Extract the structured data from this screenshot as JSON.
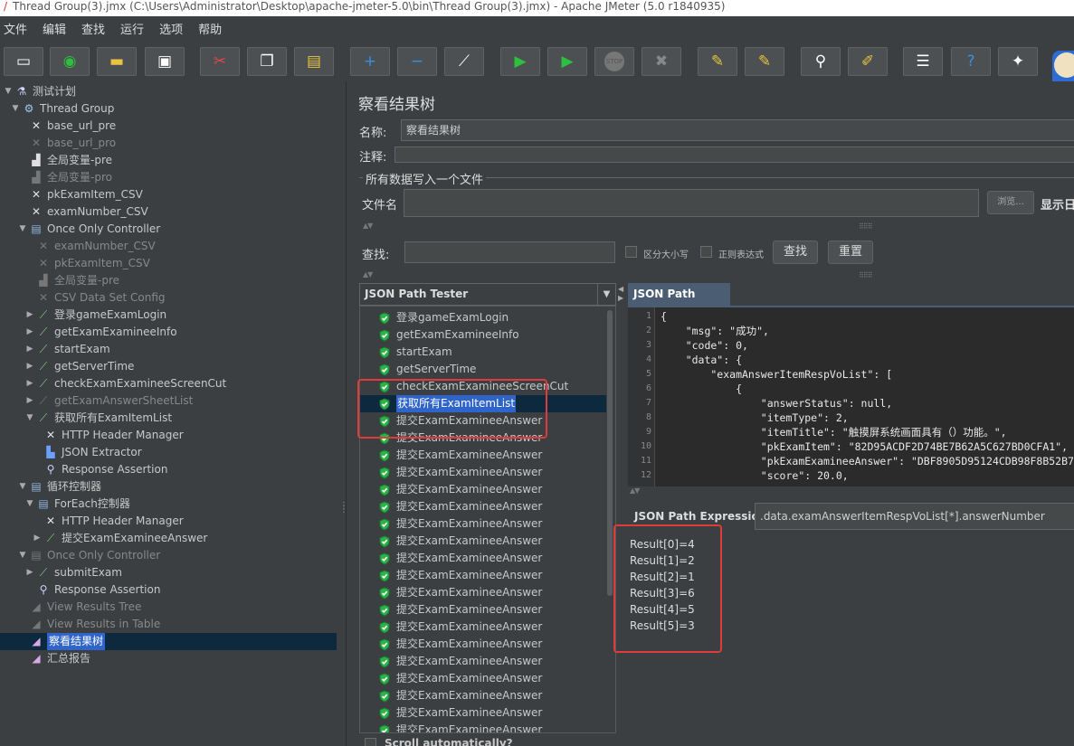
{
  "window": {
    "title": "Thread Group(3).jmx (C:\\Users\\Administrator\\Desktop\\apache-jmeter-5.0\\bin\\Thread Group(3).jmx) - Apache JMeter (5.0 r1840935)"
  },
  "menu": [
    "文件",
    "编辑",
    "查找",
    "运行",
    "选项",
    "帮助"
  ],
  "toolbar": {
    "icons": [
      "new-icon",
      "templates-icon",
      "open-icon",
      "save-icon",
      "cut-icon",
      "copy-icon",
      "paste-icon",
      "expand-icon",
      "collapse-icon",
      "toggle-icon",
      "start-icon",
      "start-no-pause-icon",
      "stop-icon",
      "shutdown-icon",
      "clear-icon",
      "clear-all-icon",
      "search-icon",
      "reset-search-icon",
      "function-helper-icon",
      "help-icon",
      "remote-icon"
    ],
    "stop_text": "STOP"
  },
  "tree": [
    {
      "label": "测试计划",
      "level": 0,
      "arrow": "▼",
      "icon": "flask-icon",
      "disabled": false
    },
    {
      "label": "Thread Group",
      "level": 1,
      "arrow": "▼",
      "icon": "gear-icon",
      "disabled": false
    },
    {
      "label": "base_url_pre",
      "level": 2,
      "arrow": "",
      "icon": "config-tool-icon",
      "disabled": false
    },
    {
      "label": "base_url_pro",
      "level": 2,
      "arrow": "",
      "icon": "config-tool-icon",
      "disabled": true
    },
    {
      "label": "全局变量-pre",
      "level": 2,
      "arrow": "",
      "icon": "preprocessor-icon",
      "disabled": false
    },
    {
      "label": "全局变量-pro",
      "level": 2,
      "arrow": "",
      "icon": "preprocessor-icon",
      "disabled": true
    },
    {
      "label": "pkExamItem_CSV",
      "level": 2,
      "arrow": "",
      "icon": "config-tool-icon",
      "disabled": false
    },
    {
      "label": "examNumber_CSV",
      "level": 2,
      "arrow": "",
      "icon": "config-tool-icon",
      "disabled": false
    },
    {
      "label": "Once Only Controller",
      "level": 2,
      "arrow": "▼",
      "icon": "controller-icon",
      "disabled": false
    },
    {
      "label": "examNumber_CSV",
      "level": 3,
      "arrow": "",
      "icon": "config-tool-icon",
      "disabled": true
    },
    {
      "label": "pkExamItem_CSV",
      "level": 3,
      "arrow": "",
      "icon": "config-tool-icon",
      "disabled": true
    },
    {
      "label": "全局变量-pre",
      "level": 3,
      "arrow": "",
      "icon": "preprocessor-icon",
      "disabled": true
    },
    {
      "label": "CSV Data Set Config",
      "level": 3,
      "arrow": "",
      "icon": "config-tool-icon",
      "disabled": true
    },
    {
      "label": "登录gameExamLogin",
      "level": 3,
      "arrow": "▶",
      "icon": "sampler-icon",
      "disabled": false
    },
    {
      "label": "getExamExamineeInfo",
      "level": 3,
      "arrow": "▶",
      "icon": "sampler-icon",
      "disabled": false
    },
    {
      "label": "startExam",
      "level": 3,
      "arrow": "▶",
      "icon": "sampler-icon",
      "disabled": false
    },
    {
      "label": "getServerTime",
      "level": 3,
      "arrow": "▶",
      "icon": "sampler-icon",
      "disabled": false
    },
    {
      "label": "checkExamExamineeScreenCut",
      "level": 3,
      "arrow": "▶",
      "icon": "sampler-icon",
      "disabled": false
    },
    {
      "label": "getExamAnswerSheetList",
      "level": 3,
      "arrow": "▶",
      "icon": "sampler-icon",
      "disabled": true
    },
    {
      "label": "获取所有ExamItemList",
      "level": 3,
      "arrow": "▼",
      "icon": "sampler-icon",
      "disabled": false
    },
    {
      "label": "HTTP Header Manager",
      "level": 4,
      "arrow": "",
      "icon": "config-tool-icon",
      "disabled": false
    },
    {
      "label": "JSON Extractor",
      "level": 4,
      "arrow": "",
      "icon": "extractor-icon",
      "disabled": false
    },
    {
      "label": "Response Assertion",
      "level": 4,
      "arrow": "",
      "icon": "assertion-icon",
      "disabled": false
    },
    {
      "label": "循环控制器",
      "level": 2,
      "arrow": "▼",
      "icon": "controller-icon",
      "disabled": false
    },
    {
      "label": "ForEach控制器",
      "level": 3,
      "arrow": "▼",
      "icon": "controller-icon",
      "disabled": false
    },
    {
      "label": "HTTP Header Manager",
      "level": 4,
      "arrow": "",
      "icon": "config-tool-icon",
      "disabled": false
    },
    {
      "label": "提交ExamExamineeAnswer",
      "level": 4,
      "arrow": "▶",
      "icon": "sampler-icon",
      "disabled": false
    },
    {
      "label": "Once Only Controller",
      "level": 2,
      "arrow": "▼",
      "icon": "controller-icon",
      "disabled": true
    },
    {
      "label": "submitExam",
      "level": 3,
      "arrow": "▶",
      "icon": "sampler-icon",
      "disabled": false
    },
    {
      "label": "Response Assertion",
      "level": 3,
      "arrow": "",
      "icon": "assertion-icon",
      "disabled": false
    },
    {
      "label": "View Results Tree",
      "level": 2,
      "arrow": "",
      "icon": "listener-icon",
      "disabled": true
    },
    {
      "label": "View Results in Table",
      "level": 2,
      "arrow": "",
      "icon": "listener-icon",
      "disabled": true
    },
    {
      "label": "察看结果树",
      "level": 2,
      "arrow": "",
      "icon": "listener-icon",
      "disabled": false,
      "selected": true
    },
    {
      "label": "汇总报告",
      "level": 2,
      "arrow": "",
      "icon": "listener-icon",
      "disabled": false
    }
  ],
  "panel": {
    "title": "察看结果树",
    "name_label": "名称:",
    "name_value": "察看结果树",
    "comment_label": "注释:",
    "comment_value": "",
    "file_group_legend": "所有数据写入一个文件",
    "filename_label": "文件名",
    "filename_value": "",
    "browse_label": "浏览...",
    "display_label": "显示日",
    "search_label": "查找:",
    "search_value": "",
    "case_sensitive_label": "区分大小写",
    "regex_label": "正则表达式",
    "search_button": "查找",
    "reset_button": "重置",
    "renderer": "JSON Path Tester",
    "scroll_auto_label": "Scroll automatically?"
  },
  "results": [
    {
      "label": "登录gameExamLogin"
    },
    {
      "label": "getExamExamineeInfo"
    },
    {
      "label": "startExam"
    },
    {
      "label": "getServerTime"
    },
    {
      "label": "checkExamExamineeScreenCut"
    },
    {
      "label": "获取所有ExamItemList",
      "selected": true
    },
    {
      "label": "提交ExamExamineeAnswer"
    },
    {
      "label": "提交ExamExamineeAnswer"
    },
    {
      "label": "提交ExamExamineeAnswer"
    },
    {
      "label": "提交ExamExamineeAnswer"
    },
    {
      "label": "提交ExamExamineeAnswer"
    },
    {
      "label": "提交ExamExamineeAnswer"
    },
    {
      "label": "提交ExamExamineeAnswer"
    },
    {
      "label": "提交ExamExamineeAnswer"
    },
    {
      "label": "提交ExamExamineeAnswer"
    },
    {
      "label": "提交ExamExamineeAnswer"
    },
    {
      "label": "提交ExamExamineeAnswer"
    },
    {
      "label": "提交ExamExamineeAnswer"
    },
    {
      "label": "提交ExamExamineeAnswer"
    },
    {
      "label": "提交ExamExamineeAnswer"
    },
    {
      "label": "提交ExamExamineeAnswer"
    },
    {
      "label": "提交ExamExamineeAnswer"
    },
    {
      "label": "提交ExamExamineeAnswer"
    },
    {
      "label": "提交ExamExamineeAnswer"
    },
    {
      "label": "提交ExamExamineeAnswer"
    }
  ],
  "tester": {
    "tab_label": "JSON Path Tester",
    "code_lines": [
      {
        "n": "1",
        "text": "{"
      },
      {
        "n": "2",
        "text": "    \"msg\": \"成功\","
      },
      {
        "n": "3",
        "text": "    \"code\": 0,"
      },
      {
        "n": "4",
        "text": "    \"data\": {"
      },
      {
        "n": "5",
        "text": "        \"examAnswerItemRespVoList\": ["
      },
      {
        "n": "6",
        "text": "            {"
      },
      {
        "n": "7",
        "text": "                \"answerStatus\": null,"
      },
      {
        "n": "8",
        "text": "                \"itemType\": 2,"
      },
      {
        "n": "9",
        "text": "                \"itemTitle\": \"触摸屏系统画面具有（）功能。\","
      },
      {
        "n": "10",
        "text": "                \"pkExamItem\": \"82D95ACDF2D74BE7B62A5C627BD0CFA1\","
      },
      {
        "n": "11",
        "text": "                \"pkExamExamineeAnswer\": \"DBF8905D95124CDB98F8B52B7"
      },
      {
        "n": "12",
        "text": "                \"score\": 20.0,"
      }
    ],
    "expression_label": "JSON Path Expression",
    "expression_value": ".data.examAnswerItemRespVoList[*].answerNumber",
    "results": [
      "Result[0]=4",
      "Result[1]=2",
      "Result[2]=1",
      "Result[3]=6",
      "Result[4]=5",
      "Result[5]=3"
    ]
  }
}
